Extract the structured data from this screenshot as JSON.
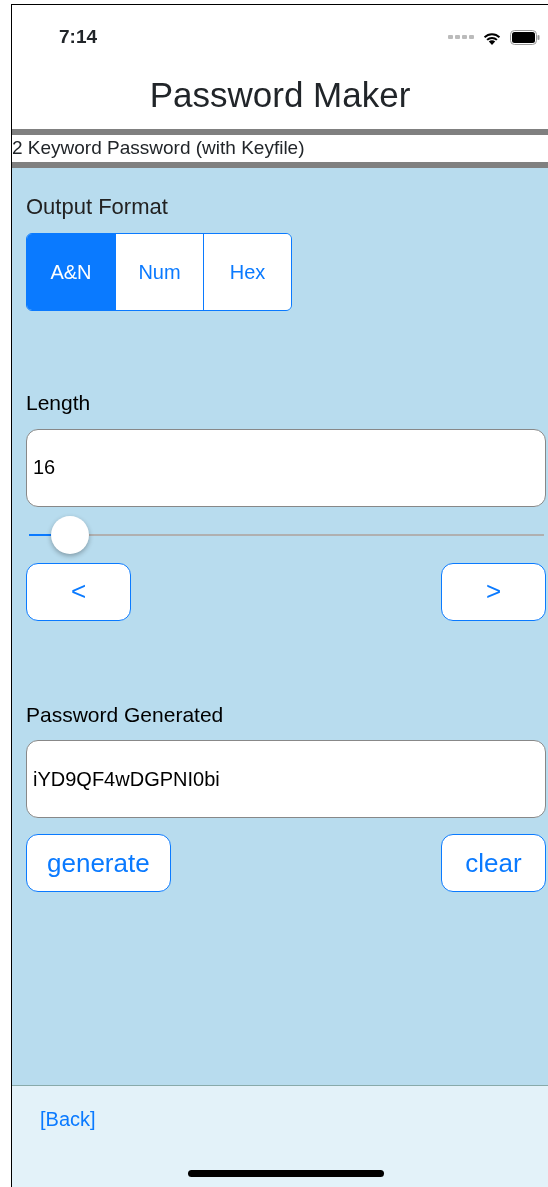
{
  "status_bar": {
    "time": "7:14"
  },
  "title": "Password Maker",
  "subtitle": "2 Keyword Password (with Keyfile)",
  "output_format": {
    "label": "Output Format",
    "options": [
      {
        "label": "A&N",
        "selected": true
      },
      {
        "label": "Num",
        "selected": false
      },
      {
        "label": "Hex",
        "selected": false
      }
    ]
  },
  "length": {
    "label": "Length",
    "value": "16",
    "level": 0.08,
    "buttons": [
      "<",
      ">"
    ]
  },
  "password": {
    "label": "Password Generated",
    "value": "iYD9QF4wDGPNI0bi",
    "buttons": [
      "generate",
      "clear"
    ]
  },
  "footer": {
    "link": "[Back]"
  }
}
